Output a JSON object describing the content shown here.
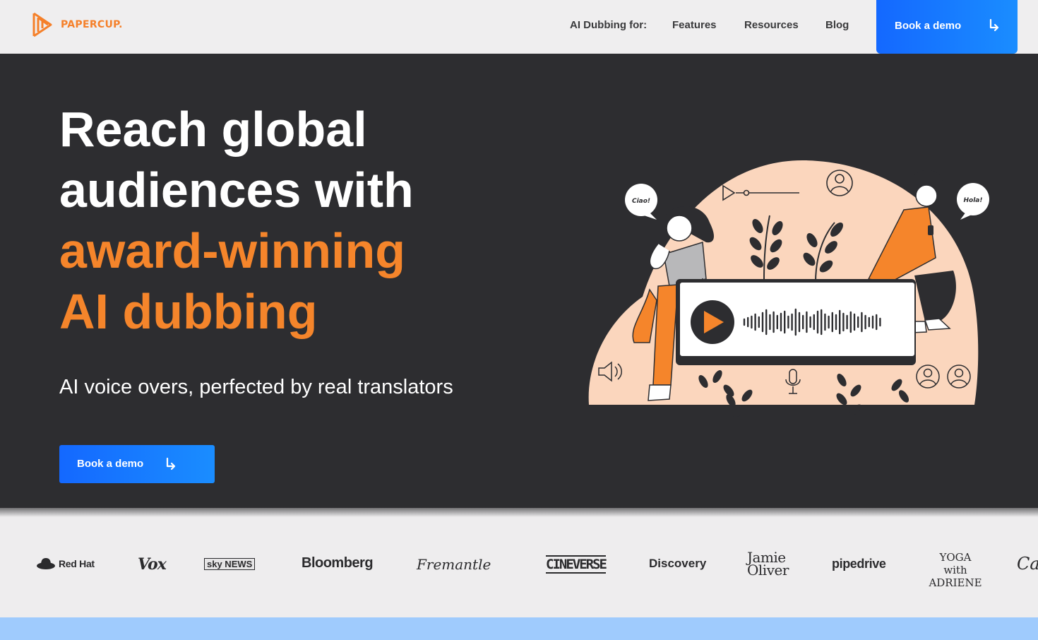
{
  "header": {
    "logo_text": "PAPERCUP.",
    "nav": [
      {
        "label": "AI Dubbing for:"
      },
      {
        "label": "Features"
      },
      {
        "label": "Resources"
      },
      {
        "label": "Blog"
      }
    ],
    "cta_label": "Book a demo"
  },
  "hero": {
    "headline_line1": "Reach global",
    "headline_line2": "audiences with",
    "headline_line3": "award-winning",
    "headline_line4": "AI dubbing",
    "subheadline": "AI voice overs, perfected by real translators",
    "cta_label": "Book a demo",
    "illustration": {
      "left_bubble": "Ciao!",
      "right_bubble": "Hola!"
    }
  },
  "logos": [
    "Red Hat",
    "Vox",
    "sky NEWS",
    "Bloomberg",
    "Fremantle",
    "CINEVERSE",
    "Discovery",
    "Jamie Oliver",
    "pipedrive",
    "YOGA with ADRIENE",
    "Ca"
  ],
  "colors": {
    "brand_orange": "#f5852b",
    "hero_bg": "#2d2d30",
    "cta_blue": "#1468ff",
    "peach": "#fbd6bd"
  }
}
